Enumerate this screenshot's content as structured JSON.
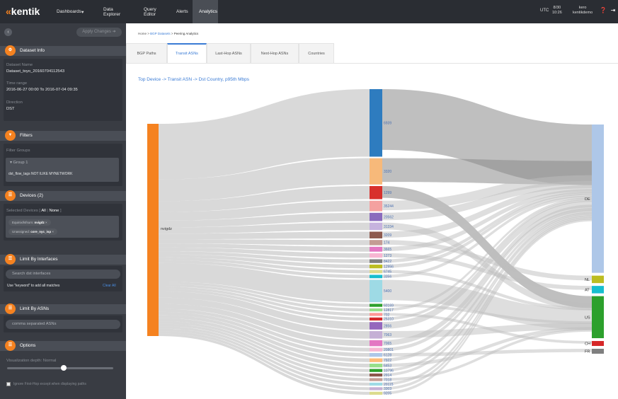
{
  "app": {
    "logo": "kentik",
    "nav": [
      "Dashboards",
      "Data Explorer",
      "Query Editor",
      "Alerts",
      "Analytics"
    ],
    "active_nav": "Analytics",
    "utc_label": "UTC",
    "clock_date": "8/30",
    "clock_time": "10:26",
    "user_name": "kero",
    "user_org": "kentikdemo",
    "help_icon": "help-icon",
    "logout_icon": "logout-icon"
  },
  "sidebar": {
    "apply_label": "Apply Changes",
    "dataset": {
      "title": "Dataset Info",
      "name_label": "Dataset Name",
      "name_value": "Dataset_toyo_20160704112543",
      "range_label": "Time range",
      "range_value": "2016-06-27 00:00  To  2016-07-04 09:35",
      "direction_label": "Direction",
      "direction_value": "DST"
    },
    "filters": {
      "title": "Filters",
      "groups_label": "Filter Groups",
      "group_name": "Group 1",
      "group_rule": "dst_flow_tags NOT ILIKE MYNETWORK"
    },
    "devices": {
      "title": "Devices (2)",
      "selected_label": "Selected Devices",
      "all_label": "All",
      "none_label": "None",
      "chip1_prefix": "Equinix/lsfsum:",
      "chip1_value": "nvigdz",
      "chip2_prefix": "Unassigned:",
      "chip2_value": "core_nyc_isp"
    },
    "interfaces": {
      "title": "Limit By Interfaces",
      "placeholder": "Search dst interfaces",
      "hint": "Use \"keyword\" to add all matches",
      "clear": "Clear All"
    },
    "asns": {
      "title": "Limit By ASNs",
      "placeholder": "comma separated ASNs"
    },
    "options": {
      "title": "Options",
      "depth_label": "Visualization depth: Normal",
      "checkbox_label": "Ignore First-Hop except when displaying paths"
    }
  },
  "main": {
    "breadcrumb": [
      "Home",
      "BGP Datasets",
      "Peering Analytics"
    ],
    "tabs": [
      "BGP Paths",
      "Transit ASNs",
      "Last-Hop ASNs",
      "Next-Hop ASNs",
      "Countries"
    ],
    "active_tab": "Transit ASNs",
    "chart_title": "Top Device -> Transit ASN -> Dst Country, p95th Mbps"
  },
  "sankey": {
    "device": {
      "label": "nvigdz",
      "color": "#f58220"
    },
    "asns": [
      {
        "label": "6939",
        "color": "#2e7cbf",
        "weight": 18
      },
      {
        "label": "3320",
        "color": "#f7b97a",
        "weight": 7
      },
      {
        "label": "1299",
        "color": "#d8302c",
        "weight": 3.5
      },
      {
        "label": "35244",
        "color": "#f4a1a0",
        "weight": 2.8
      },
      {
        "label": "20562",
        "color": "#8a6bbd",
        "weight": 2.2
      },
      {
        "label": "31334",
        "color": "#c6b3de",
        "weight": 2
      },
      {
        "label": "3209",
        "color": "#8e5a4f",
        "weight": 1.8
      },
      {
        "label": "174",
        "color": "#c49c94",
        "weight": 1.4
      },
      {
        "label": "3665",
        "color": "#e377c2",
        "weight": 1.3
      },
      {
        "label": "1273",
        "color": "#f7b6d2",
        "weight": 1.2
      },
      {
        "label": "8422",
        "color": "#7f7f7f",
        "weight": 1
      },
      {
        "label": "12956",
        "color": "#bcbd22",
        "weight": 1
      },
      {
        "label": "6745",
        "color": "#dbdb8d",
        "weight": 0.9
      },
      {
        "label": "3356",
        "color": "#17becf",
        "weight": 0.9
      },
      {
        "label": "5400",
        "color": "#9edae5",
        "weight": 6
      },
      {
        "label": "60169",
        "color": "#2ca02c",
        "weight": 0.8
      },
      {
        "label": "12817",
        "color": "#98df8a",
        "weight": 0.8
      },
      {
        "label": "702",
        "color": "#ff9896",
        "weight": 0.8
      },
      {
        "label": "25310",
        "color": "#d62728",
        "weight": 0.8
      },
      {
        "label": "2856",
        "color": "#9467bd",
        "weight": 2
      },
      {
        "label": "7063",
        "color": "#c5b0d5",
        "weight": 2
      },
      {
        "label": "7065",
        "color": "#e377c2",
        "weight": 1.6
      },
      {
        "label": "20801",
        "color": "#f7b6d2",
        "weight": 1
      },
      {
        "label": "6128",
        "color": "#aec7e8",
        "weight": 1
      },
      {
        "label": "7922",
        "color": "#ffbb78",
        "weight": 1
      },
      {
        "label": "6453",
        "color": "#98df8a",
        "weight": 1
      },
      {
        "label": "10796",
        "color": "#2ca02c",
        "weight": 0.8
      },
      {
        "label": "2914",
        "color": "#8c564b",
        "weight": 0.8
      },
      {
        "label": "7018",
        "color": "#c49c94",
        "weight": 0.8
      },
      {
        "label": "20115",
        "color": "#9edae5",
        "weight": 0.8
      },
      {
        "label": "3303",
        "color": "#c5b0d5",
        "weight": 0.8
      },
      {
        "label": "9205",
        "color": "#dbdb8d",
        "weight": 0.8
      }
    ],
    "countries": [
      {
        "label": "DE",
        "color": "#aec7e8",
        "weight": 60
      },
      {
        "label": "NL",
        "color": "#bcbd22",
        "weight": 3
      },
      {
        "label": "AT",
        "color": "#17becf",
        "weight": 3
      },
      {
        "label": "US",
        "color": "#2ca02c",
        "weight": 17
      },
      {
        "label": "CH",
        "color": "#d62728",
        "weight": 2
      },
      {
        "label": "FR",
        "color": "#7f7f7f",
        "weight": 2
      }
    ]
  }
}
